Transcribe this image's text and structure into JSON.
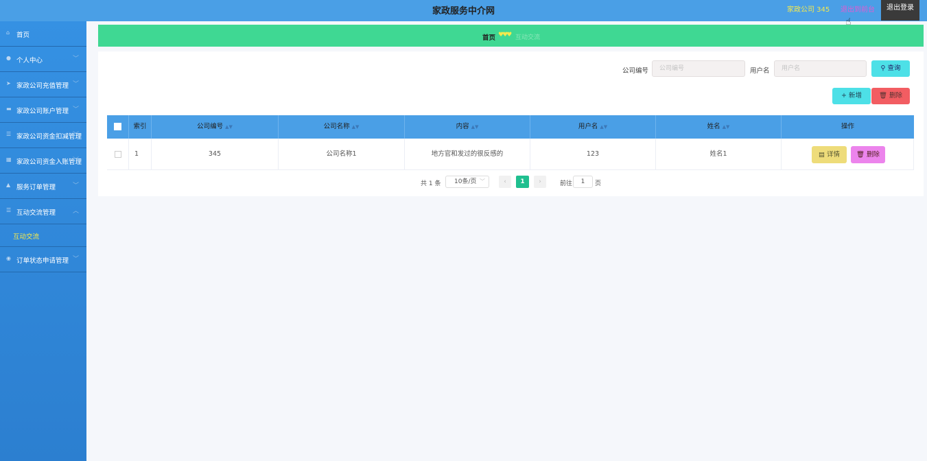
{
  "header": {
    "title": "家政服务中介网",
    "user": "家政公司 345",
    "back_label": "退出到前台",
    "logout_label": "退出登录"
  },
  "sidebar": {
    "items": [
      {
        "label": "首页",
        "icon": "home-icon",
        "arrow": ""
      },
      {
        "label": "个人中心",
        "icon": "user-icon",
        "arrow": "﹀"
      },
      {
        "label": "家政公司充值管理",
        "icon": "send-icon",
        "arrow": "﹀"
      },
      {
        "label": "家政公司账户管理",
        "icon": "wallet-icon",
        "arrow": "﹀"
      },
      {
        "label": "家政公司资金扣减管理",
        "icon": "list-icon",
        "arrow": "﹀"
      },
      {
        "label": "家政公司资金入账管理",
        "icon": "grid-icon",
        "arrow": "﹀"
      },
      {
        "label": "服务订单管理",
        "icon": "thumb-icon",
        "arrow": "﹀"
      },
      {
        "label": "互动交流管理",
        "icon": "menu-icon",
        "arrow": "︿"
      }
    ],
    "sub_item": "互动交流",
    "last_item": {
      "label": "订单状态申请管理",
      "icon": "location-icon",
      "arrow": "﹀"
    }
  },
  "breadcrumb": {
    "home": "首页",
    "separator": "♥♥♥",
    "current": "互动交流"
  },
  "search": {
    "company_no_label": "公司编号",
    "company_no_placeholder": "公司编号",
    "username_label": "用户名",
    "username_placeholder": "用户名",
    "query_label": "查询"
  },
  "actions": {
    "add_label": "+ 新增",
    "delete_label": "删除"
  },
  "table": {
    "columns": [
      "索引",
      "公司编号",
      "公司名称",
      "内容",
      "用户名",
      "姓名",
      "操作"
    ],
    "rows": [
      {
        "index": "1",
        "company_no": "345",
        "company_name": "公司名称1",
        "content": "地方官和发过的很反感的",
        "username": "123",
        "name": "姓名1",
        "detail_label": "详情",
        "delete_label": "删除"
      }
    ]
  },
  "pagination": {
    "total": "共 1 条",
    "page_size": "10条/页",
    "current_page": "1",
    "goto_label": "前往",
    "goto_value": "1",
    "page_suffix": "页"
  },
  "colors": {
    "header": "#4a9fe6",
    "sidebar": "#3591e3",
    "breadcrumb": "#3fd893",
    "accent_yellow": "#f5e94d"
  }
}
